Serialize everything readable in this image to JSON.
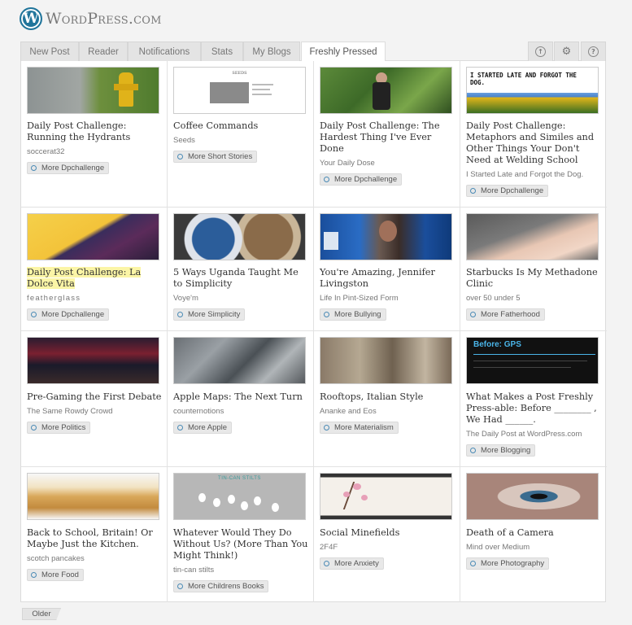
{
  "header": {
    "logo_letter": "W",
    "brand_text": "WordPress.com"
  },
  "tabs": [
    {
      "label": "New Post"
    },
    {
      "label": "Reader"
    },
    {
      "label": "Notifications"
    },
    {
      "label": "Stats"
    },
    {
      "label": "My Blogs"
    },
    {
      "label": "Freshly Pressed",
      "active": true
    }
  ],
  "tools": [
    {
      "icon": "upload-icon",
      "glyph": "↑"
    },
    {
      "icon": "gear-icon",
      "glyph": "⚙"
    },
    {
      "icon": "help-icon",
      "glyph": "?"
    }
  ],
  "posts": [
    {
      "title": "Daily Post Challenge: Running the Hydrants",
      "source": "soccerat32",
      "more": "More Dpchallenge"
    },
    {
      "title": "Coffee Commands",
      "source": "Seeds",
      "more": "More Short Stories",
      "thumb_text": "SEEDS"
    },
    {
      "title": "Daily Post Challenge: The Hardest Thing I've Ever Done",
      "source": "Your Daily Dose",
      "more": "More Dpchallenge"
    },
    {
      "title": "Daily Post Challenge: Metaphors and Similes and Other Things Your Don't Need at Welding School",
      "source": "I Started Late and Forgot the Dog.",
      "more": "More Dpchallenge",
      "thumb_text": "I STARTED LATE AND FORGOT THE DOG."
    },
    {
      "title": "Daily Post Challenge: La Dolce Vita",
      "source": "featherglass",
      "more": "More Dpchallenge"
    },
    {
      "title": "5 Ways Uganda Taught Me to Simplicity",
      "source": "Voye'm",
      "more": "More Simplicity"
    },
    {
      "title": "You're Amazing, Jennifer Livingston",
      "source": "Life In Pint-Sized Form",
      "more": "More Bullying"
    },
    {
      "title": "Starbucks Is My Methadone Clinic",
      "source": "over 50 under 5",
      "more": "More Fatherhood"
    },
    {
      "title": "Pre-Gaming the First Debate",
      "source": "The Same Rowdy Crowd",
      "more": "More Politics"
    },
    {
      "title": "Apple Maps: The Next Turn",
      "source": "counternotions",
      "more": "More Apple"
    },
    {
      "title": "Rooftops, Italian Style",
      "source": "Ananke and Eos",
      "more": "More Materialism"
    },
    {
      "title": "What Makes a Post Freshly Press-able: Before ________ , We Had ______.",
      "source": "The Daily Post at WordPress.com",
      "more": "More Blogging",
      "thumb_text": "Before: GPS"
    },
    {
      "title": "Back to School, Britain! Or Maybe Just the Kitchen.",
      "source": "scotch pancakes",
      "more": "More Food"
    },
    {
      "title": "Whatever Would They Do Without Us? (More Than You Might Think!)",
      "source": "tin-can stilts",
      "more": "More Childrens Books",
      "thumb_text": "TIN-CAN STILTS"
    },
    {
      "title": "Social Minefields",
      "source": "2F4F",
      "more": "More Anxiety"
    },
    {
      "title": "Death of a Camera",
      "source": "Mind over Medium",
      "more": "More Photography"
    }
  ],
  "pagination": {
    "older_label": "Older"
  }
}
